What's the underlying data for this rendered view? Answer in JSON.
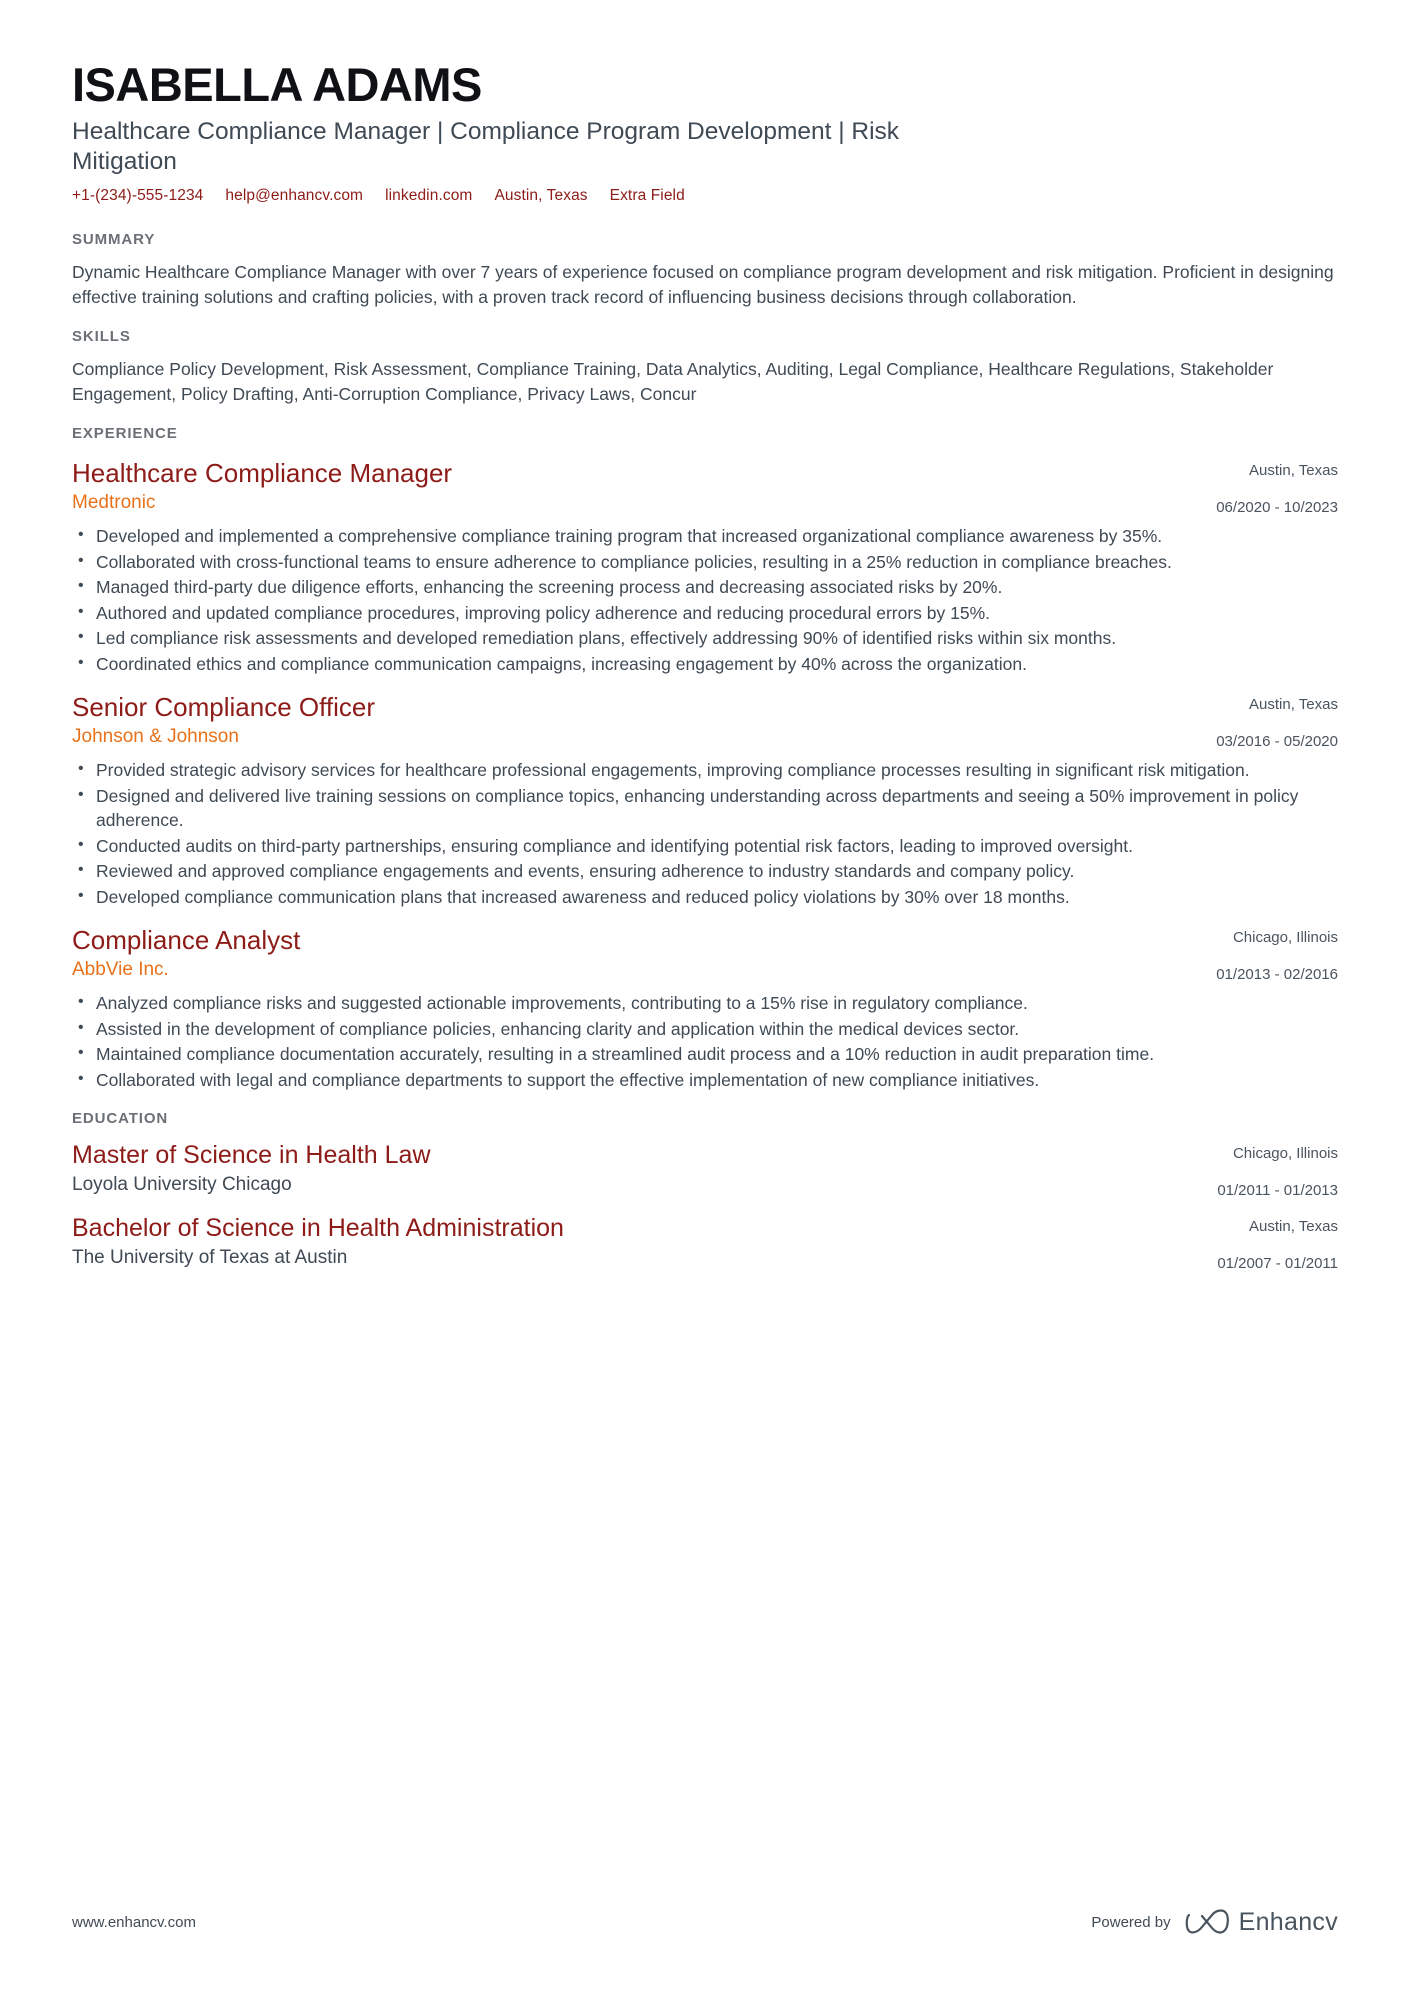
{
  "header": {
    "name": "ISABELLA ADAMS",
    "headline": "Healthcare Compliance Manager | Compliance Program Development | Risk Mitigation",
    "contacts": [
      {
        "label": "+1-(234)-555-1234",
        "icon": "phone-icon"
      },
      {
        "label": "help@enhancv.com",
        "icon": "email-icon"
      },
      {
        "label": "linkedin.com",
        "icon": "linkedin-icon"
      },
      {
        "label": "Austin, Texas",
        "icon": "location-icon"
      },
      {
        "label": "Extra Field",
        "icon": "extra-icon"
      }
    ]
  },
  "colors": {
    "name": "#0f1115",
    "heading": "#6b7076",
    "accent_red": "#8d1b17",
    "accent_orange": "#e8711a",
    "body": "#3f4a55"
  },
  "summary": {
    "title": "SUMMARY",
    "text": "Dynamic Healthcare Compliance Manager with over 7 years of experience focused on compliance program development and risk mitigation. Proficient in designing effective training solutions and crafting policies, with a proven track record of influencing business decisions through collaboration."
  },
  "skills": {
    "title": "SKILLS",
    "text": "Compliance Policy Development, Risk Assessment, Compliance Training, Data Analytics, Auditing, Legal Compliance, Healthcare Regulations, Stakeholder Engagement, Policy Drafting, Anti-Corruption Compliance, Privacy Laws, Concur"
  },
  "experience": {
    "title": "EXPERIENCE",
    "entries": [
      {
        "role": "Healthcare Compliance Manager",
        "company": "Medtronic",
        "location": "Austin, Texas",
        "dates": "06/2020 - 10/2023",
        "bullets": [
          "Developed and implemented a comprehensive compliance training program that increased organizational compliance awareness by 35%.",
          "Collaborated with cross-functional teams to ensure adherence to compliance policies, resulting in a 25% reduction in compliance breaches.",
          "Managed third-party due diligence efforts, enhancing the screening process and decreasing associated risks by 20%.",
          "Authored and updated compliance procedures, improving policy adherence and reducing procedural errors by 15%.",
          "Led compliance risk assessments and developed remediation plans, effectively addressing 90% of identified risks within six months.",
          "Coordinated ethics and compliance communication campaigns, increasing engagement by 40% across the organization."
        ]
      },
      {
        "role": "Senior Compliance Officer",
        "company": "Johnson & Johnson",
        "location": "Austin, Texas",
        "dates": "03/2016 - 05/2020",
        "bullets": [
          "Provided strategic advisory services for healthcare professional engagements, improving compliance processes resulting in significant risk mitigation.",
          "Designed and delivered live training sessions on compliance topics, enhancing understanding across departments and seeing a 50% improvement in policy adherence.",
          "Conducted audits on third-party partnerships, ensuring compliance and identifying potential risk factors, leading to improved oversight.",
          "Reviewed and approved compliance engagements and events, ensuring adherence to industry standards and company policy.",
          "Developed compliance communication plans that increased awareness and reduced policy violations by 30% over 18 months."
        ]
      },
      {
        "role": "Compliance Analyst",
        "company": "AbbVie Inc.",
        "location": "Chicago, Illinois",
        "dates": "01/2013 - 02/2016",
        "bullets": [
          "Analyzed compliance risks and suggested actionable improvements, contributing to a 15% rise in regulatory compliance.",
          "Assisted in the development of compliance policies, enhancing clarity and application within the medical devices sector.",
          "Maintained compliance documentation accurately, resulting in a streamlined audit process and a 10% reduction in audit preparation time.",
          "Collaborated with legal and compliance departments to support the effective implementation of new compliance initiatives."
        ]
      }
    ]
  },
  "education": {
    "title": "EDUCATION",
    "entries": [
      {
        "degree": "Master of Science in Health Law",
        "school": "Loyola University Chicago",
        "location": "Chicago, Illinois",
        "dates": "01/2011 - 01/2013"
      },
      {
        "degree": "Bachelor of Science in Health Administration",
        "school": "The University of Texas at Austin",
        "location": "Austin, Texas",
        "dates": "01/2007 - 01/2011"
      }
    ]
  },
  "footer": {
    "url": "www.enhancv.com",
    "powered_by": "Powered by",
    "brand": "Enhancv"
  }
}
